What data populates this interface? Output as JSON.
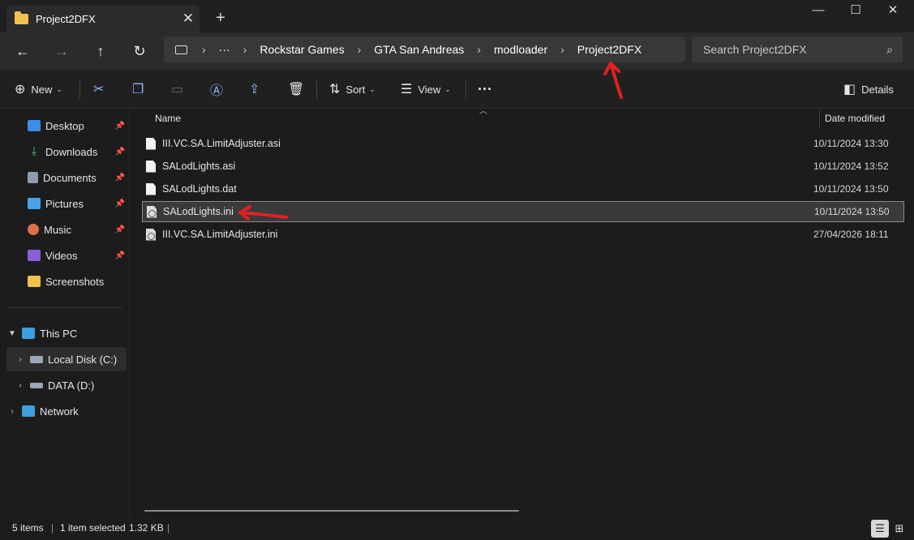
{
  "window": {
    "tab_title": "Project2DFX",
    "tab_close": "✕",
    "new_tab": "+",
    "minimize": "—",
    "maximize": "☐",
    "close": "✕"
  },
  "nav": {
    "back": "←",
    "forward": "→",
    "up": "↑",
    "refresh": "↻",
    "breadcrumb": [
      "Rockstar Games",
      "GTA San Andreas",
      "modloader",
      "Project2DFX"
    ],
    "overflow": "···",
    "separator": "›",
    "search_placeholder": "Search Project2DFX",
    "search_icon": "⌕"
  },
  "toolbar": {
    "new_label": "New",
    "sort_label": "Sort",
    "view_label": "View",
    "details_label": "Details",
    "more": "···"
  },
  "sidebar": {
    "pinned": [
      {
        "label": "Desktop",
        "icon": "desktop-icon",
        "color": "#3a8ee6"
      },
      {
        "label": "Downloads",
        "icon": "download-icon",
        "color": "#46c46e"
      },
      {
        "label": "Documents",
        "icon": "document-icon",
        "color": "#8a9bb3"
      },
      {
        "label": "Pictures",
        "icon": "picture-icon",
        "color": "#4aa3e8"
      },
      {
        "label": "Music",
        "icon": "music-icon",
        "color": "#e0704a"
      },
      {
        "label": "Videos",
        "icon": "video-icon",
        "color": "#8b5ed8"
      },
      {
        "label": "Screenshots",
        "icon": "folder-icon",
        "color": "#f3c24b"
      }
    ],
    "this_pc": "This PC",
    "local_disk": "Local Disk (C:)",
    "data_drive": "DATA (D:)",
    "network": "Network"
  },
  "files": {
    "col_name": "Name",
    "col_date": "Date modified",
    "rows": [
      {
        "name": "III.VC.SA.LimitAdjuster.asi",
        "date": "10/11/2024 13:30",
        "type": "file"
      },
      {
        "name": "SALodLights.asi",
        "date": "10/11/2024 13:52",
        "type": "file"
      },
      {
        "name": "SALodLights.dat",
        "date": "10/11/2024 13:50",
        "type": "file"
      },
      {
        "name": "SALodLights.ini",
        "date": "10/11/2024 13:50",
        "type": "ini",
        "selected": true
      },
      {
        "name": "III.VC.SA.LimitAdjuster.ini",
        "date": "27/04/2026 18:11",
        "type": "ini"
      }
    ]
  },
  "status": {
    "items": "5 items",
    "selected": "1 item selected",
    "size": "1.32 KB",
    "divider": "|"
  },
  "colors": {
    "annotation_arrow": "#e0211f",
    "accent": "#8fb8ff"
  }
}
